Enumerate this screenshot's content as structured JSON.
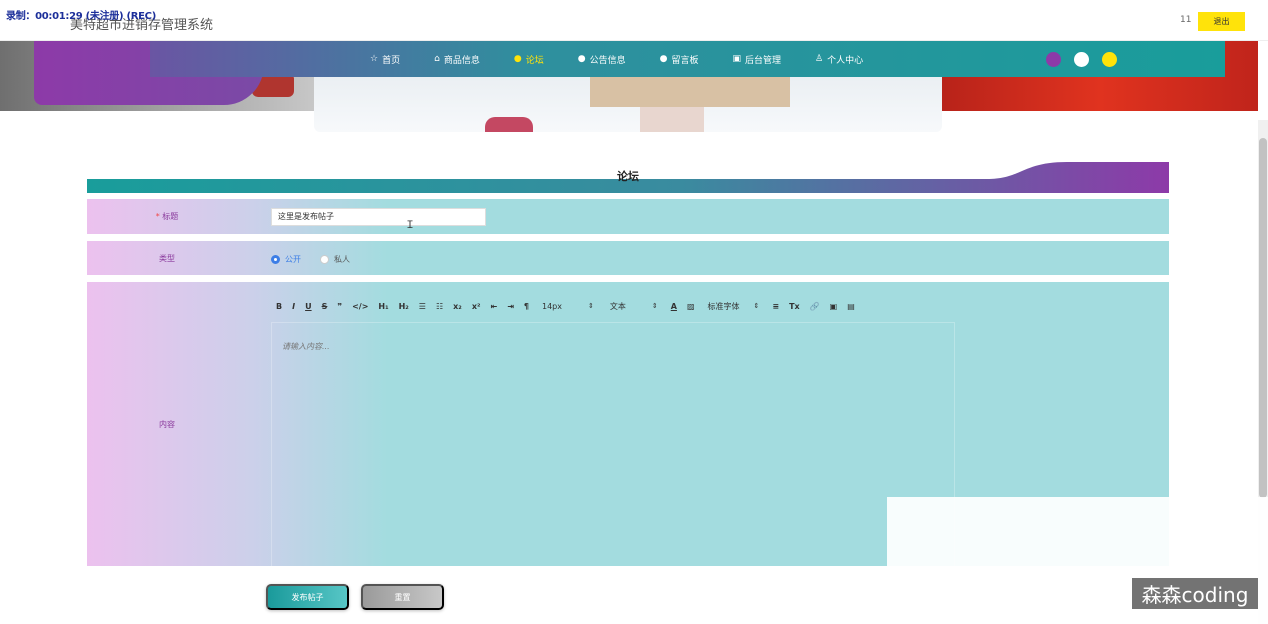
{
  "recording": "录制：00:01:29 (未注册) (REC)",
  "app": {
    "title": "美特超市进销存管理系统"
  },
  "header": {
    "user_count": "11",
    "logout_label": "退出"
  },
  "nav": {
    "items": [
      {
        "icon": "☆",
        "label": "首页",
        "active": false
      },
      {
        "icon": "⌂",
        "label": "商品信息",
        "active": false
      },
      {
        "icon": "●",
        "label": "论坛",
        "active": true
      },
      {
        "icon": "●",
        "label": "公告信息",
        "active": false
      },
      {
        "icon": "●",
        "label": "留言板",
        "active": false
      },
      {
        "icon": "▣",
        "label": "后台管理",
        "active": false
      },
      {
        "icon": "♙",
        "label": "个人中心",
        "active": false
      }
    ],
    "theme_dots": [
      "#8d3aa8",
      "#ffffff",
      "#ffe30a"
    ]
  },
  "form": {
    "title": "论坛",
    "title_label": "标题",
    "required_mark": "*",
    "title_value": "这里是发布帖子",
    "type_label": "类型",
    "type_options": [
      {
        "label": "公开",
        "selected": true
      },
      {
        "label": "私人",
        "selected": false
      }
    ],
    "content_label": "内容",
    "editor": {
      "toolbar": [
        "B",
        "I",
        "U",
        "S",
        "❞",
        "</>",
        "H₁",
        "H₂",
        "☰",
        "☷",
        "x₂",
        "x²",
        "⇤",
        "⇥",
        "¶",
        "A",
        "▨",
        "≡",
        "Tx",
        "🔗",
        "▣",
        "▤"
      ],
      "font_size": "14px",
      "paragraph": "文本",
      "font_family": "标准字体",
      "placeholder": "请输入内容..."
    },
    "submit_label": "发布帖子",
    "reset_label": "重置"
  },
  "watermark": "森森coding"
}
